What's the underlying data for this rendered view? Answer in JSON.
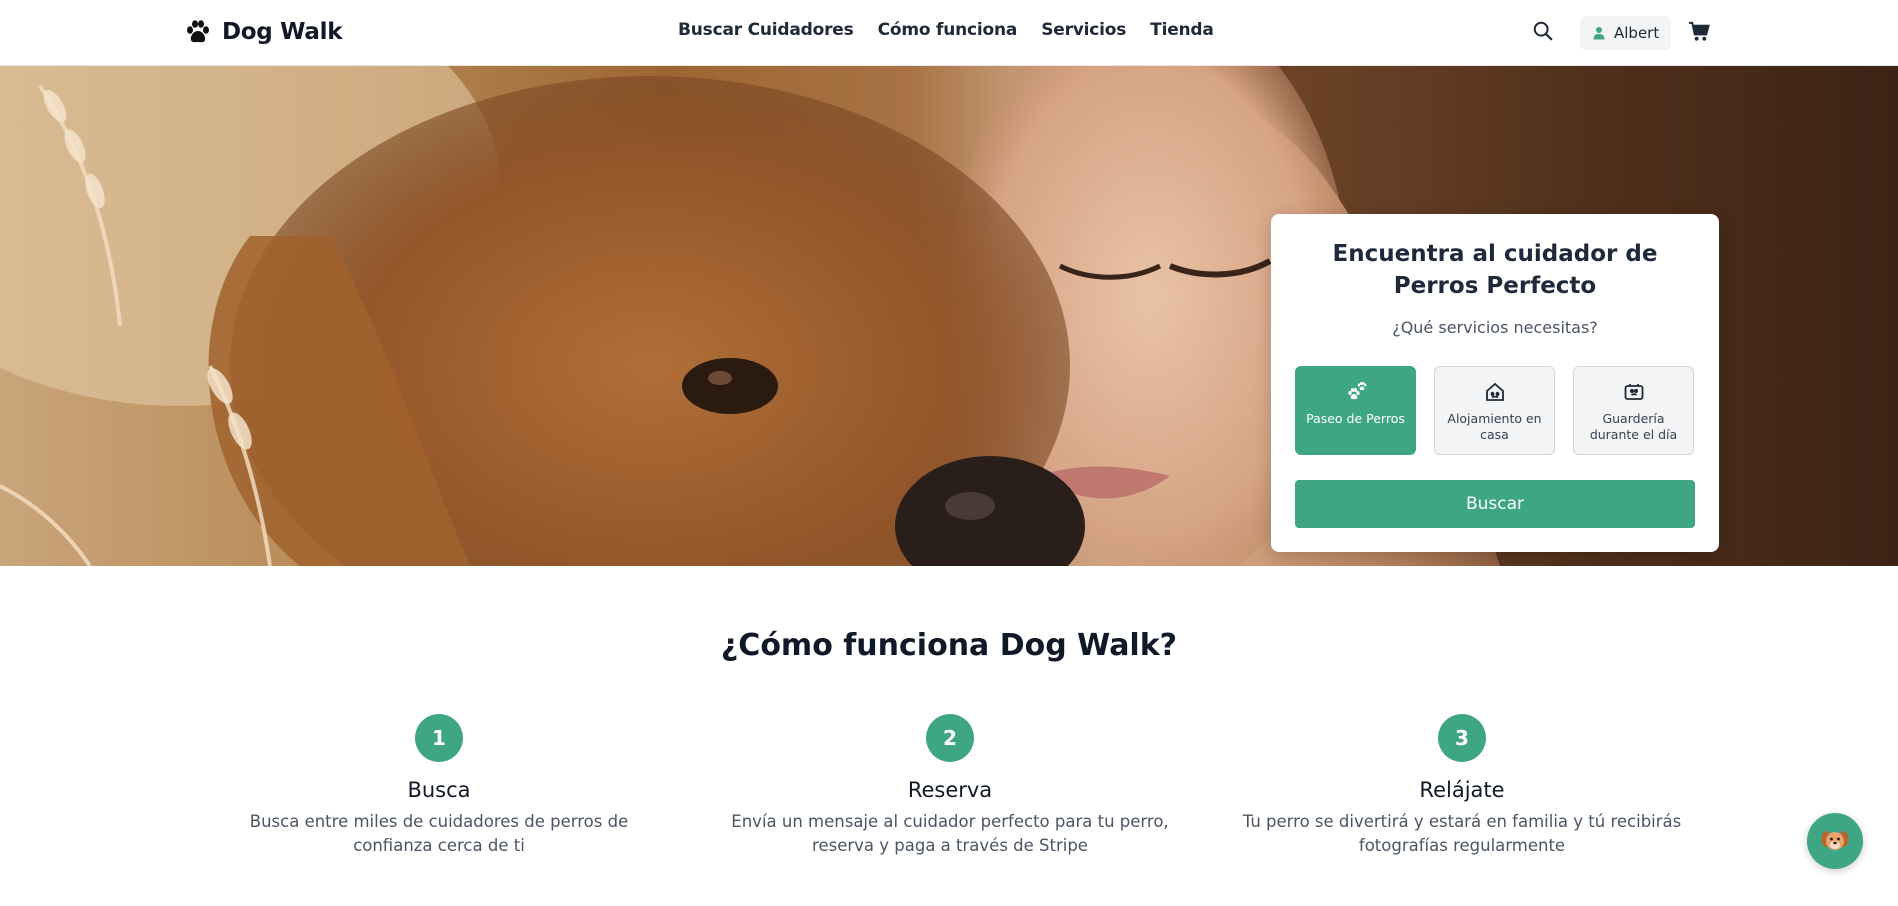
{
  "brand": {
    "name": "Dog Walk",
    "icon": "paw-icon"
  },
  "nav": {
    "items": [
      {
        "label": "Buscar Cuidadores"
      },
      {
        "label": "Cómo funciona"
      },
      {
        "label": "Servicios"
      },
      {
        "label": "Tienda"
      }
    ]
  },
  "header_actions": {
    "search_icon": "search-icon",
    "user_label": "Albert",
    "user_icon": "user-icon",
    "cart_icon": "cart-icon"
  },
  "search_card": {
    "title": "Encuentra al cuidador de Perros Perfecto",
    "subtitle": "¿Qué servicios necesitas?",
    "services": [
      {
        "label": "Paseo de Perros",
        "icon": "paws-icon",
        "selected": true
      },
      {
        "label": "Alojamiento en casa",
        "icon": "house-icon",
        "selected": false
      },
      {
        "label": "Guardería durante el día",
        "icon": "daycare-icon",
        "selected": false
      }
    ],
    "button_label": "Buscar"
  },
  "how_it_works": {
    "title": "¿Cómo funciona Dog Walk?",
    "steps": [
      {
        "number": "1",
        "title": "Busca",
        "description": "Busca entre miles de cuidadores de perros de confianza cerca de ti"
      },
      {
        "number": "2",
        "title": "Reserva",
        "description": "Envía un mensaje al cuidador perfecto para tu perro, reserva y paga a través de Stripe"
      },
      {
        "number": "3",
        "title": "Relájate",
        "description": "Tu perro se divertirá y estará en familia y tú recibirás fotografías regularmente"
      }
    ]
  },
  "chat": {
    "icon": "dog-face-icon"
  },
  "colors": {
    "accent": "#3fa685",
    "text_dark": "#111827",
    "muted": "#4b5563"
  }
}
